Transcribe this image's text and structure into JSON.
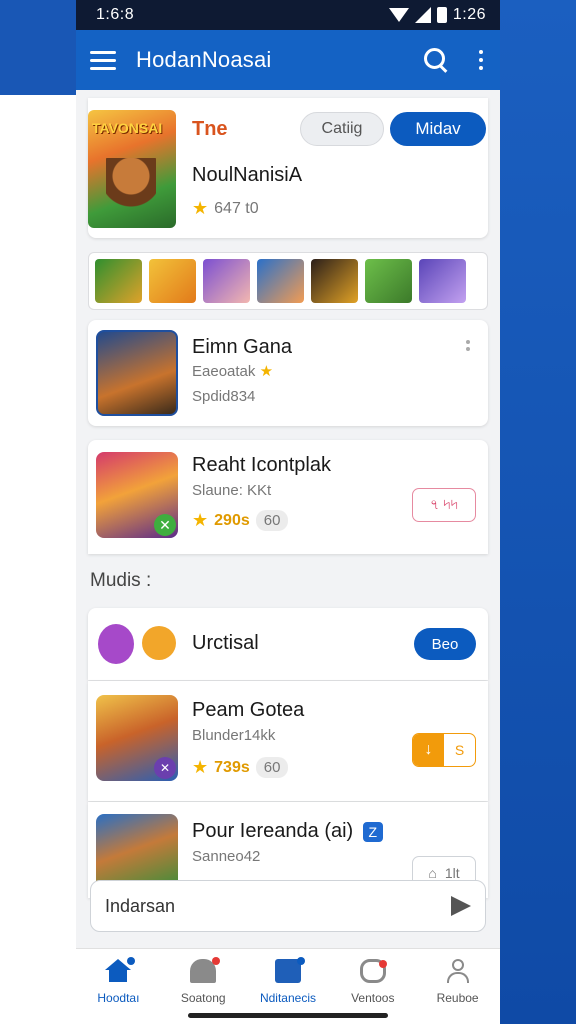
{
  "status_bar": {
    "time": "1:6:8",
    "battery_text": "1:26"
  },
  "app_bar": {
    "title": "HodanNoasai"
  },
  "featured": {
    "art_logo": "TAVONSAI",
    "tag": "Tne",
    "outline_button": "Catiig",
    "primary_button": "Midav",
    "name": "NoulNanisiA",
    "rating": "647 t0"
  },
  "list1": [
    {
      "title": "Eimn Gana",
      "sub1": "Eaeoatak",
      "sub2": "Spdid834"
    },
    {
      "title": "Reaht Icontplak",
      "sub1": "Slaune: KKt",
      "rating": "290s",
      "count": "60",
      "action": "৭ ৸৸"
    }
  ],
  "section": {
    "title": "Mudis :"
  },
  "promo": {
    "title": "Urctisal",
    "button": "Beo"
  },
  "list2": [
    {
      "title": "Peam Gotea",
      "sub1": "Blunder14kk",
      "rating": "739s",
      "count": "60",
      "action": "S"
    },
    {
      "title": "Pour Iereanda (ai)",
      "badge": "Z",
      "sub1": "Sanneo42",
      "action": "1lt"
    }
  ],
  "input": {
    "placeholder": "Indarsan"
  },
  "bottom_nav": [
    {
      "label": "Hoodtaı"
    },
    {
      "label": "Soatong"
    },
    {
      "label": "Nditanecis"
    },
    {
      "label": "Ventoos"
    },
    {
      "label": "Reuboe"
    }
  ],
  "colors": {
    "primary": "#0c5bbf",
    "accent_orange": "#f29b0b",
    "star": "#f4b400"
  }
}
